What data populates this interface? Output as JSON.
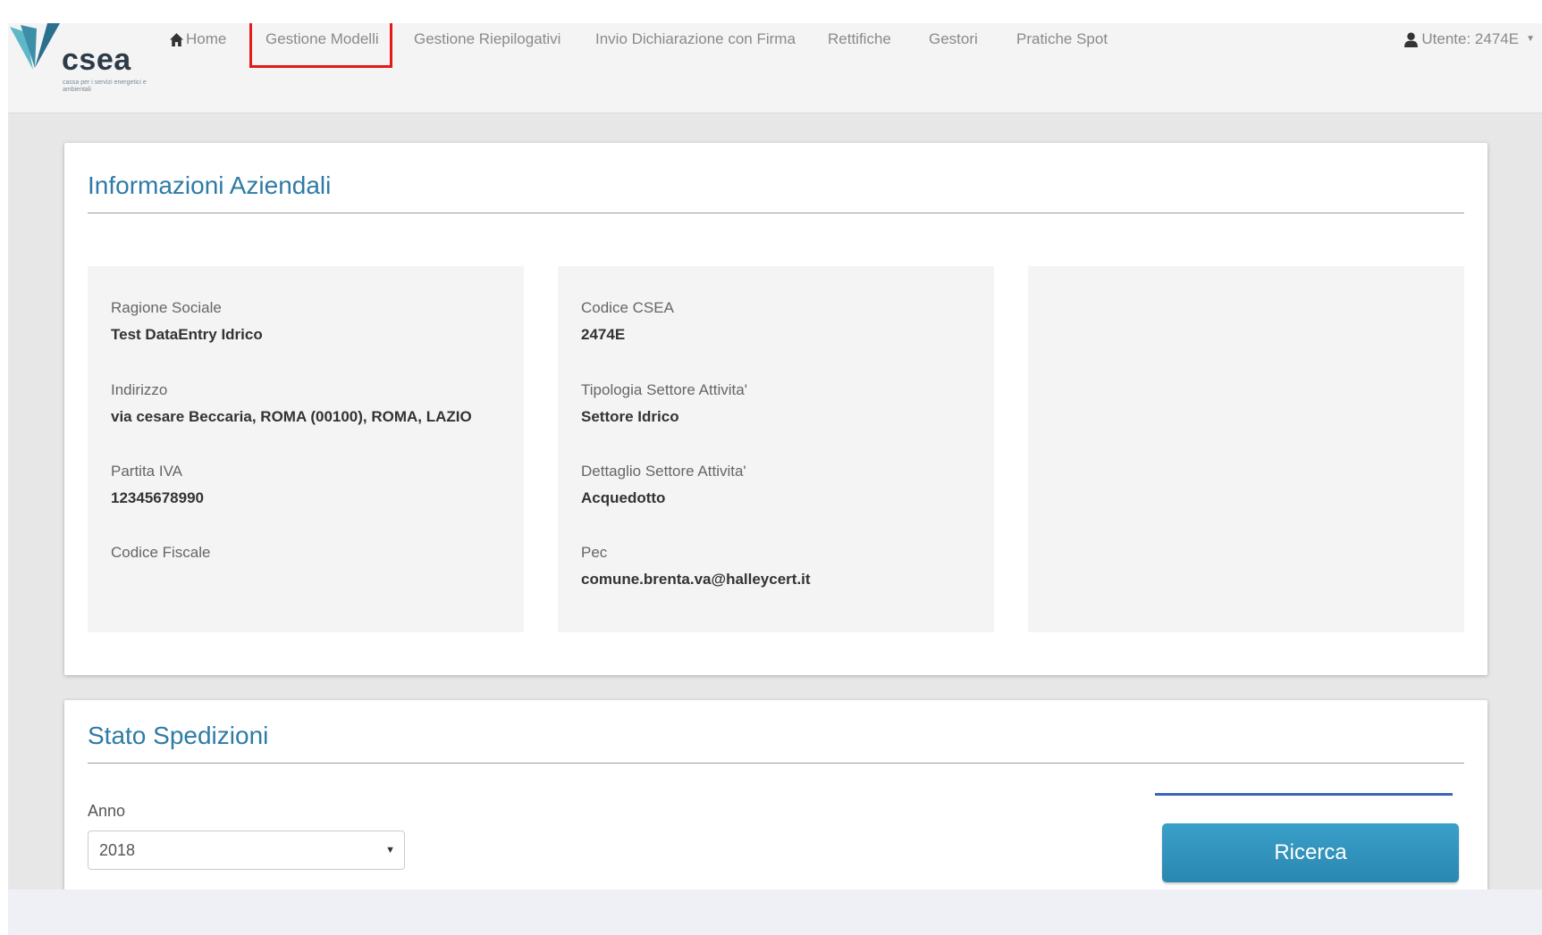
{
  "brand": {
    "name": "csea",
    "tagline": "cassa per i servizi energetici e ambientali"
  },
  "nav": {
    "home": "Home",
    "items": [
      "Gestione Modelli",
      "Gestione Riepilogativi",
      "Invio Dichiarazione con Firma",
      "Rettifiche",
      "Gestori",
      "Pratiche Spot"
    ],
    "user": "Utente: 2474E"
  },
  "info": {
    "title": "Informazioni Aziendali",
    "col1": [
      {
        "label": "Ragione Sociale",
        "value": "Test DataEntry Idrico"
      },
      {
        "label": "Indirizzo",
        "value": "via cesare Beccaria, ROMA (00100), ROMA, LAZIO"
      },
      {
        "label": "Partita IVA",
        "value": "12345678990"
      },
      {
        "label": "Codice Fiscale",
        "value": ""
      }
    ],
    "col2": [
      {
        "label": "Codice CSEA",
        "value": "2474E"
      },
      {
        "label": "Tipologia Settore Attivita'",
        "value": "Settore Idrico"
      },
      {
        "label": "Dettaglio Settore Attivita'",
        "value": "Acquedotto"
      },
      {
        "label": "Pec",
        "value": "comune.brenta.va@halleycert.it"
      }
    ]
  },
  "spedizioni": {
    "title": "Stato Spedizioni",
    "anno_label": "Anno",
    "anno_value": "2018",
    "search_button": "Ricerca"
  },
  "colors": {
    "accent": "#2e7ba6",
    "highlight": "#e21a1a",
    "button": "#3aa0c9"
  },
  "icons": {
    "home": "home-icon",
    "user": "user-icon",
    "select": "chevron-down-icon"
  }
}
